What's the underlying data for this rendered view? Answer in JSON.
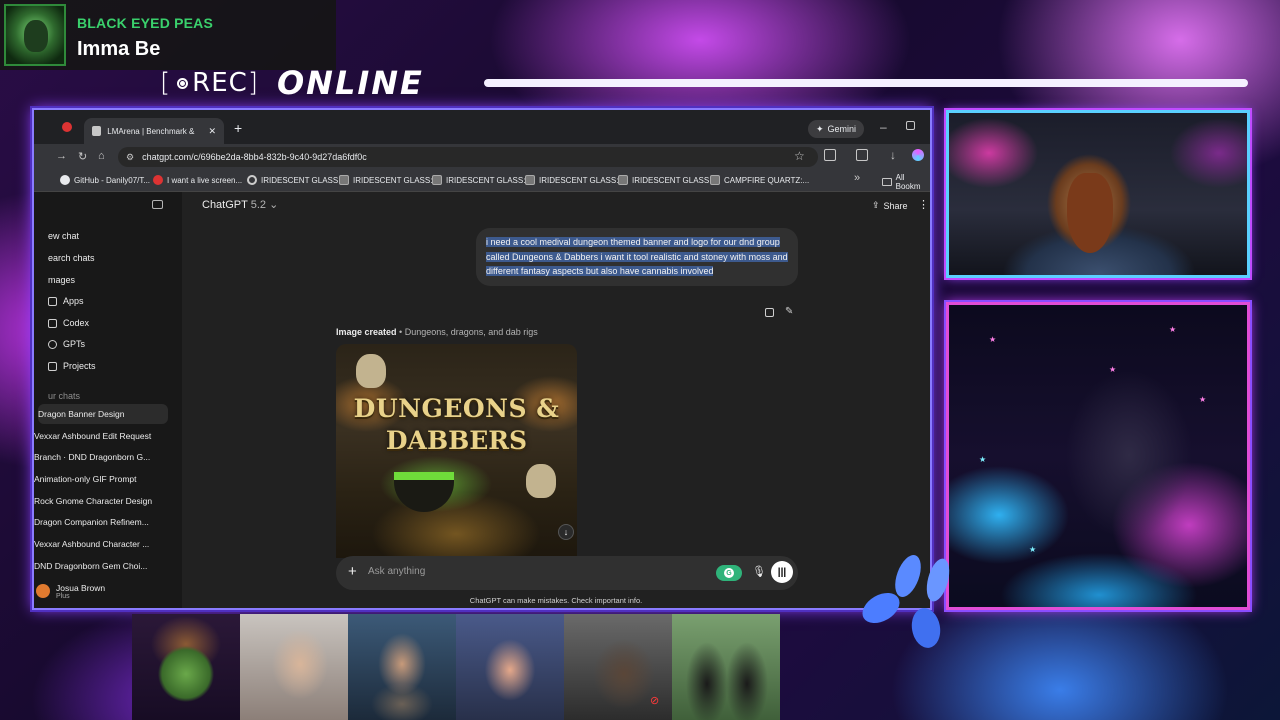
{
  "now_playing": {
    "artist": "BLACK EYED PEAS",
    "track": "Imma Be"
  },
  "overlay": {
    "rec_label": "REC",
    "online_label": "ONLINE"
  },
  "browser": {
    "tab_title": "LMArena | Benchmark & Comp",
    "gemini_label": "Gemini",
    "url": "chatgpt.com/c/696be2da-8bb4-832b-9c40-9d27da6fdf0c",
    "bookmarks": [
      {
        "label": "GitHub - Danily07/T...",
        "icon": "github-icon"
      },
      {
        "label": "I want a live screen...",
        "icon": "reddit-icon"
      },
      {
        "label": "IRIDESCENT GLASS:...",
        "icon": "circle-icon"
      },
      {
        "label": "IRIDESCENT GLASS:...",
        "icon": "image-icon"
      },
      {
        "label": "IRIDESCENT GLASS:...",
        "icon": "image-icon"
      },
      {
        "label": "IRIDESCENT GLASS:...",
        "icon": "image-icon"
      },
      {
        "label": "IRIDESCENT GLASS:...",
        "icon": "image-icon"
      },
      {
        "label": "CAMPFIRE QUARTZ:...",
        "icon": "image-icon"
      }
    ],
    "bookmarks_folder": "All Bookm"
  },
  "sidebar": {
    "items": [
      {
        "label": "ew chat"
      },
      {
        "label": "earch chats"
      },
      {
        "label": "mages"
      },
      {
        "label": "Apps"
      },
      {
        "label": "Codex"
      },
      {
        "label": "GPTs"
      },
      {
        "label": "Projects"
      }
    ],
    "section_label": "ur chats",
    "chats": [
      "Dragon Banner Design",
      "Vexxar Ashbound Edit Request",
      "Branch · DND Dragonborn G...",
      "Animation-only GIF Prompt",
      "Rock Gnome Character Design",
      "Dragon Companion Refinem...",
      "Vexxar Ashbound Character ...",
      "DND Dragonborn Gem Choi..."
    ],
    "user": {
      "name": "Josua Brown",
      "plan": "Plus"
    }
  },
  "chat": {
    "model": "ChatGPT",
    "model_version": "5.2",
    "share_label": "Share",
    "user_message": "i need a cool medival dungeon themed banner and logo for our dnd group called Dungeons & Dabbers i want it tool realistic and stoney with moss and different fantasy aspects but also have cannabis involved",
    "image_created_label": "Image created",
    "image_created_title": "Dungeons, dragons, and dab rigs",
    "image_text_line1": "DUNGEONS &",
    "image_text_line2": "DABBERS",
    "composer_placeholder": "Ask anything",
    "disclaimer": "ChatGPT can make mistakes. Check important info."
  }
}
